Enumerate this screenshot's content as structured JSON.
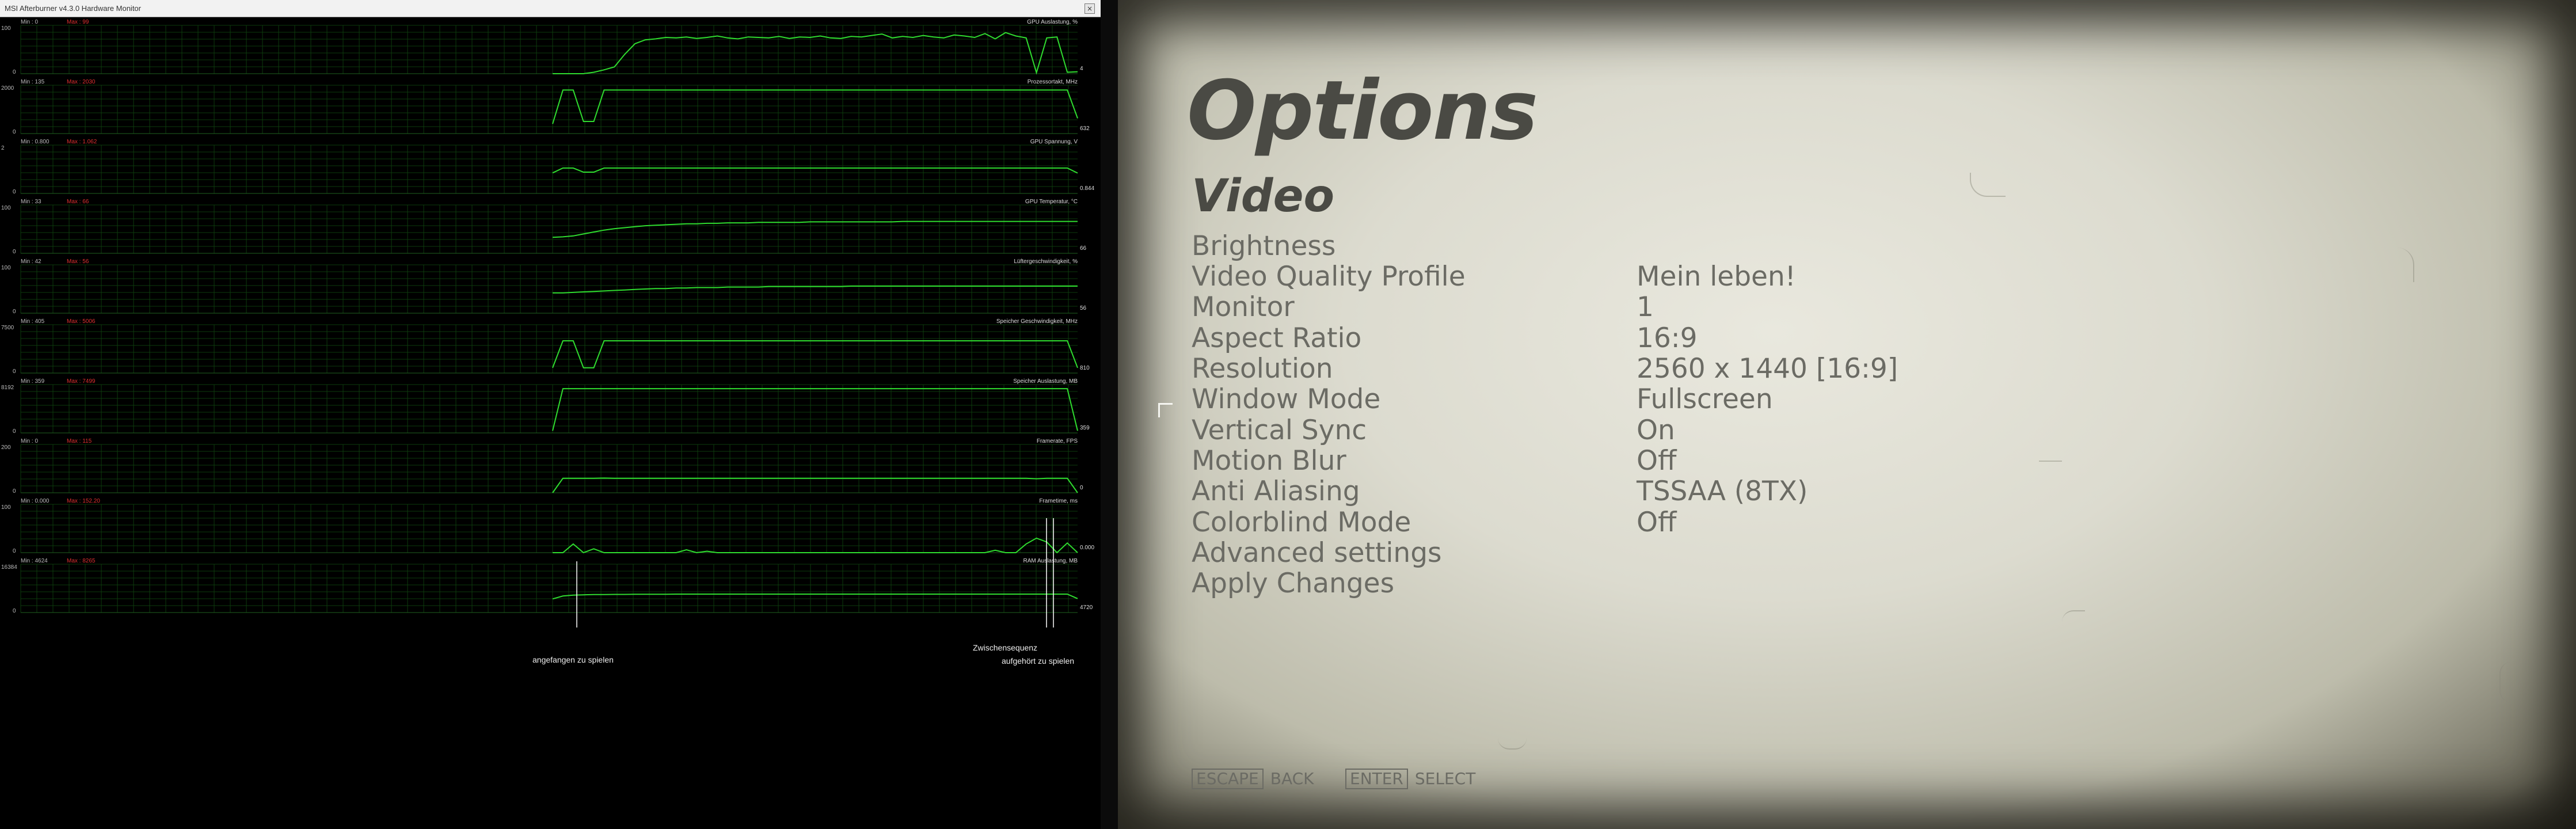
{
  "monitor": {
    "window_title": "MSI Afterburner v4.3.0 Hardware Monitor",
    "panels": [
      {
        "name": "GPU Auslastung, %",
        "min_label": "Min : 0",
        "max_label": "Max : 99",
        "scale_top": "100",
        "scale_bottom": "0",
        "current": "4",
        "series": [
          0,
          0,
          0,
          0,
          3,
          8,
          14,
          40,
          62,
          70,
          72,
          75,
          74,
          76,
          73,
          75,
          78,
          74,
          72,
          76,
          75,
          74,
          77,
          73,
          76,
          75,
          78,
          74,
          73,
          77,
          76,
          79,
          82,
          74,
          77,
          75,
          79,
          76,
          74,
          80,
          78,
          75,
          83,
          72,
          85,
          78,
          74,
          2,
          74,
          76,
          3,
          4
        ]
      },
      {
        "name": "Prozessortakt, MHz",
        "min_label": "Min : 135",
        "max_label": "Max : 2030",
        "scale_top": "2000",
        "scale_bottom": "0",
        "current": "632",
        "series": [
          400,
          1800,
          1800,
          500,
          500,
          1800,
          1800,
          1800,
          1800,
          1800,
          1800,
          1800,
          1800,
          1800,
          1800,
          1800,
          1800,
          1800,
          1800,
          1800,
          1800,
          1800,
          1800,
          1800,
          1800,
          1800,
          1800,
          1800,
          1800,
          1800,
          1800,
          1800,
          1800,
          1800,
          1800,
          1800,
          1800,
          1800,
          1800,
          1800,
          1800,
          1800,
          1800,
          1800,
          1800,
          1800,
          1800,
          1800,
          1800,
          1800,
          1800,
          632
        ]
      },
      {
        "name": "GPU Spannung, V",
        "min_label": "Min : 0.800",
        "max_label": "Max : 1.062",
        "scale_top": "2",
        "scale_bottom": "0",
        "current": "0.844",
        "series": [
          0.85,
          1.05,
          1.05,
          0.88,
          0.88,
          1.05,
          1.05,
          1.05,
          1.05,
          1.05,
          1.05,
          1.05,
          1.05,
          1.05,
          1.05,
          1.05,
          1.05,
          1.05,
          1.05,
          1.05,
          1.05,
          1.05,
          1.05,
          1.05,
          1.05,
          1.05,
          1.05,
          1.05,
          1.05,
          1.05,
          1.05,
          1.05,
          1.05,
          1.05,
          1.05,
          1.05,
          1.05,
          1.05,
          1.05,
          1.05,
          1.05,
          1.05,
          1.05,
          1.05,
          1.05,
          1.05,
          1.05,
          1.05,
          1.05,
          1.05,
          1.05,
          0.844
        ]
      },
      {
        "name": "GPU Temperatur, °C",
        "min_label": "Min : 33",
        "max_label": "Max : 66",
        "scale_top": "100",
        "scale_bottom": "0",
        "current": "66",
        "series": [
          33,
          34,
          36,
          40,
          44,
          48,
          51,
          53,
          55,
          57,
          58,
          59,
          60,
          61,
          61,
          62,
          62,
          63,
          63,
          63,
          64,
          64,
          64,
          64,
          64,
          65,
          65,
          65,
          65,
          65,
          65,
          65,
          65,
          65,
          66,
          66,
          66,
          66,
          66,
          66,
          66,
          66,
          66,
          66,
          66,
          66,
          66,
          66,
          66,
          66,
          66,
          66
        ]
      },
      {
        "name": "Lüftergeschwindigkeit, %",
        "min_label": "Min : 42",
        "max_label": "Max : 56",
        "scale_top": "100",
        "scale_bottom": "0",
        "current": "56",
        "series": [
          42,
          42,
          43,
          44,
          45,
          46,
          47,
          48,
          49,
          50,
          51,
          51,
          52,
          52,
          53,
          53,
          53,
          54,
          54,
          54,
          54,
          55,
          55,
          55,
          55,
          55,
          55,
          55,
          55,
          56,
          56,
          56,
          56,
          56,
          56,
          56,
          56,
          56,
          56,
          56,
          56,
          56,
          56,
          56,
          56,
          56,
          56,
          56,
          56,
          56,
          56,
          56
        ]
      },
      {
        "name": "Speicher Geschwindigkeit, MHz",
        "min_label": "Min : 405",
        "max_label": "Max : 5006",
        "scale_top": "7500",
        "scale_bottom": "0",
        "current": "810",
        "series": [
          810,
          5000,
          5000,
          810,
          810,
          5000,
          5000,
          5000,
          5000,
          5000,
          5000,
          5000,
          5000,
          5000,
          5000,
          5000,
          5000,
          5000,
          5000,
          5000,
          5000,
          5000,
          5000,
          5000,
          5000,
          5000,
          5000,
          5000,
          5000,
          5000,
          5000,
          5000,
          5000,
          5000,
          5000,
          5000,
          5000,
          5000,
          5000,
          5000,
          5000,
          5000,
          5000,
          5000,
          5000,
          5000,
          5000,
          5000,
          5000,
          5000,
          5000,
          810
        ]
      },
      {
        "name": "Speicher Auslastung, MB",
        "min_label": "Min : 359",
        "max_label": "Max : 7499",
        "scale_top": "8192",
        "scale_bottom": "0",
        "current": "359",
        "series": [
          359,
          7499,
          7499,
          7499,
          7499,
          7499,
          7499,
          7499,
          7499,
          7499,
          7499,
          7499,
          7499,
          7499,
          7499,
          7499,
          7499,
          7499,
          7499,
          7499,
          7499,
          7499,
          7499,
          7499,
          7499,
          7499,
          7499,
          7499,
          7499,
          7499,
          7499,
          7499,
          7499,
          7499,
          7499,
          7499,
          7499,
          7499,
          7499,
          7499,
          7499,
          7499,
          7499,
          7499,
          7499,
          7499,
          7499,
          7499,
          7499,
          7499,
          7499,
          359
        ]
      },
      {
        "name": "Framerate, FPS",
        "min_label": "Min : 0",
        "max_label": "Max : 115",
        "scale_top": "200",
        "scale_bottom": "0",
        "current": "0",
        "series": [
          0,
          60,
          60,
          60,
          60,
          61,
          60,
          60,
          60,
          60,
          60,
          60,
          60,
          60,
          60,
          60,
          60,
          60,
          60,
          60,
          60,
          60,
          60,
          60,
          60,
          60,
          60,
          60,
          60,
          60,
          60,
          60,
          60,
          60,
          60,
          60,
          60,
          60,
          60,
          60,
          60,
          60,
          60,
          60,
          60,
          60,
          60,
          58,
          60,
          60,
          60,
          0
        ]
      },
      {
        "name": "Frametime, ms",
        "min_label": "Min : 0.000",
        "max_label": "Max : 152.20",
        "scale_top": "100",
        "scale_bottom": "0",
        "current": "0.000",
        "series": [
          0,
          0,
          18,
          0,
          8,
          0,
          0,
          0,
          0,
          0,
          0,
          0,
          0,
          6,
          0,
          3,
          0,
          0,
          0,
          0,
          0,
          0,
          0,
          0,
          0,
          0,
          0,
          0,
          0,
          0,
          0,
          0,
          0,
          0,
          0,
          0,
          0,
          0,
          0,
          0,
          0,
          0,
          0,
          5,
          0,
          0,
          18,
          30,
          22,
          0,
          20,
          0
        ]
      },
      {
        "name": "RAM Auslastung, MB",
        "min_label": "Min : 4624",
        "max_label": "Max : 8265",
        "scale_top": "16384",
        "scale_bottom": "0",
        "current": "4720",
        "series": [
          4624,
          5600,
          5900,
          6000,
          6100,
          6100,
          6150,
          6150,
          6200,
          6200,
          6200,
          6200,
          6250,
          6250,
          6250,
          6250,
          6250,
          6250,
          6250,
          6250,
          6250,
          6250,
          6250,
          6250,
          6250,
          6250,
          6250,
          6250,
          6250,
          6250,
          6250,
          6250,
          6250,
          6250,
          6250,
          6250,
          6250,
          6250,
          6250,
          6250,
          6250,
          6250,
          6250,
          6250,
          6250,
          6250,
          6250,
          6250,
          6250,
          6250,
          6250,
          4720
        ]
      }
    ],
    "annotations": {
      "start": "angefangen zu spielen",
      "cutscene": "Zwischensequenz",
      "stop": "aufgehört zu spielen"
    },
    "colors": {
      "line": "#2fdc2f",
      "grid": "#0d3a0d",
      "max_label": "#e03030"
    }
  },
  "options": {
    "title": "Options",
    "section": "Video",
    "items": [
      {
        "label": "Brightness",
        "value": ""
      },
      {
        "label": "Video Quality Profile",
        "value": "Mein leben!"
      },
      {
        "label": "Monitor",
        "value": "1"
      },
      {
        "label": "Aspect Ratio",
        "value": "16:9"
      },
      {
        "label": "Resolution",
        "value": "2560 x 1440 [16:9]"
      },
      {
        "label": "Window Mode",
        "value": "Fullscreen"
      },
      {
        "label": "Vertical Sync",
        "value": "On"
      },
      {
        "label": "Motion Blur",
        "value": "Off"
      },
      {
        "label": "Anti Aliasing",
        "value": "TSSAA (8TX)"
      },
      {
        "label": "Colorblind Mode",
        "value": "Off"
      },
      {
        "label": "Advanced settings",
        "value": ""
      },
      {
        "label": "Apply Changes",
        "value": ""
      }
    ],
    "hints": {
      "escape_key": "ESCAPE",
      "escape_label": "BACK",
      "enter_key": "ENTER",
      "enter_label": "SELECT"
    }
  }
}
